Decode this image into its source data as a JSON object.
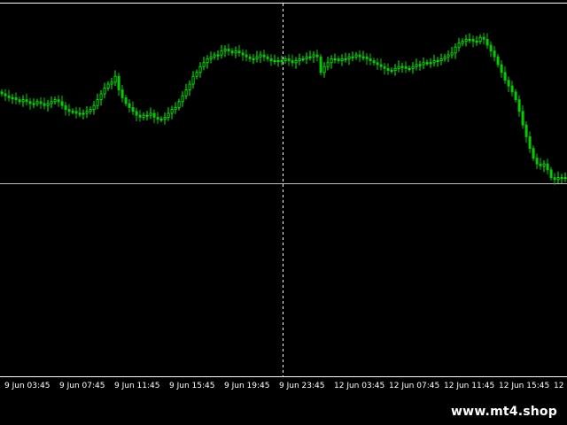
{
  "colors": {
    "background": "#000000",
    "candle_up": "#00ff00",
    "candle_down": "#00cc00",
    "grid_line": "#c0c0c0",
    "axis_text": "#ffffff",
    "frame": "#ffffff"
  },
  "watermark": {
    "text": "www.mt4.shop"
  },
  "chart_data": {
    "type": "candlestick",
    "title": "",
    "xlabel": "",
    "ylabel": "",
    "grid": false,
    "legend": "none",
    "x_tick_labels": [
      "9 Jun 03:45",
      "9 Jun 07:45",
      "9 Jun 11:45",
      "9 Jun 15:45",
      "9 Jun 19:45",
      "9 Jun 23:45",
      "12 Jun 03:45",
      "12 Jun 07:45",
      "12 Jun 11:45",
      "12 Jun 15:45",
      "12"
    ],
    "crosshair": {
      "x_tick": "9 Jun 23:45",
      "y_relative": 0.56
    },
    "series": [
      {
        "relative_close": [
          0.7,
          0.69,
          0.68,
          0.68,
          0.67,
          0.66,
          0.67,
          0.66,
          0.65,
          0.65,
          0.66,
          0.65,
          0.64,
          0.65,
          0.66,
          0.67,
          0.66,
          0.64,
          0.62,
          0.61,
          0.61,
          0.6,
          0.6,
          0.6,
          0.61,
          0.62,
          0.64,
          0.67,
          0.7,
          0.73,
          0.75,
          0.76,
          0.79,
          0.72,
          0.68,
          0.65,
          0.63,
          0.61,
          0.59,
          0.58,
          0.59,
          0.59,
          0.6,
          0.58,
          0.57,
          0.57,
          0.58,
          0.6,
          0.62,
          0.63,
          0.66,
          0.69,
          0.72,
          0.75,
          0.79,
          0.81,
          0.84,
          0.86,
          0.88,
          0.89,
          0.9,
          0.9,
          0.92,
          0.93,
          0.92,
          0.91,
          0.92,
          0.91,
          0.9,
          0.89,
          0.88,
          0.88,
          0.89,
          0.9,
          0.89,
          0.88,
          0.87,
          0.87,
          0.87,
          0.87,
          0.88,
          0.87,
          0.86,
          0.87,
          0.88,
          0.88,
          0.89,
          0.89,
          0.9,
          0.89,
          0.81,
          0.84,
          0.86,
          0.88,
          0.88,
          0.87,
          0.88,
          0.88,
          0.89,
          0.89,
          0.9,
          0.89,
          0.89,
          0.88,
          0.87,
          0.86,
          0.85,
          0.84,
          0.83,
          0.82,
          0.82,
          0.83,
          0.84,
          0.84,
          0.83,
          0.83,
          0.84,
          0.85,
          0.85,
          0.86,
          0.86,
          0.86,
          0.87,
          0.87,
          0.88,
          0.89,
          0.9,
          0.91,
          0.94,
          0.96,
          0.97,
          0.98,
          0.98,
          0.97,
          0.97,
          0.99,
          0.98,
          0.95,
          0.92,
          0.89,
          0.85,
          0.81,
          0.77,
          0.74,
          0.71,
          0.67,
          0.61,
          0.54,
          0.48,
          0.42,
          0.37,
          0.34,
          0.33,
          0.34,
          0.31,
          0.27,
          0.26,
          0.27,
          0.27,
          0.27
        ]
      }
    ]
  }
}
